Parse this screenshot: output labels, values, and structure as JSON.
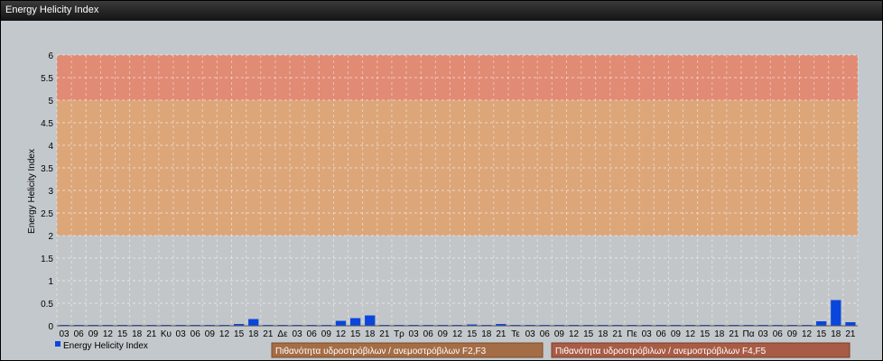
{
  "window": {
    "title": "Energy Helicity Index"
  },
  "colors": {
    "plot_bg": "#b8bec2",
    "zone_low": "#c39b82",
    "zone_mid": "#dca679",
    "zone_high": "#e18a74",
    "bar": "#0a46dc",
    "legend_f23": "#a56d45",
    "legend_f45": "#a95c45"
  },
  "chart_data": {
    "type": "bar",
    "title": "",
    "xlabel": "",
    "ylabel": "Energy Helicity Index",
    "ylim": [
      0,
      6
    ],
    "yticks": [
      "0",
      "0.5",
      "1",
      "1.5",
      "2",
      "2.5",
      "3",
      "3.5",
      "4",
      "4.5",
      "5",
      "5.5",
      "6"
    ],
    "grid": true,
    "categories": [
      "03",
      "06",
      "09",
      "12",
      "15",
      "18",
      "21",
      "Κυ",
      "03",
      "06",
      "09",
      "12",
      "15",
      "18",
      "21",
      "Δε",
      "03",
      "06",
      "09",
      "12",
      "15",
      "18",
      "21",
      "Τρ",
      "03",
      "06",
      "09",
      "12",
      "15",
      "18",
      "21",
      "Τε",
      "03",
      "06",
      "09",
      "12",
      "15",
      "18",
      "21",
      "Πε",
      "03",
      "06",
      "09",
      "12",
      "15",
      "18",
      "21",
      "Πα",
      "03",
      "06",
      "09",
      "12",
      "15",
      "18",
      "21"
    ],
    "series": [
      {
        "name": "Energy Helicity Index",
        "values": [
          0.02,
          0.02,
          0.02,
          0.02,
          0.02,
          0.02,
          0.02,
          0.02,
          0.02,
          0.02,
          0.02,
          0.02,
          0.04,
          0.15,
          0.02,
          0.02,
          0.02,
          0.02,
          0.02,
          0.11,
          0.17,
          0.23,
          0.02,
          0.02,
          0.02,
          0.02,
          0.02,
          0.02,
          0.03,
          0.02,
          0.04,
          0.02,
          0.02,
          0.02,
          0.02,
          0.02,
          0.02,
          0.02,
          0.02,
          0.02,
          0.02,
          0.02,
          0.02,
          0.02,
          0.02,
          0.02,
          0.02,
          0.02,
          0.02,
          0.02,
          0.02,
          0.02,
          0.1,
          0.57,
          0.08
        ]
      }
    ],
    "zones": [
      {
        "from": 0,
        "to": 2,
        "color": "#c2c6c9"
      },
      {
        "from": 2,
        "to": 5,
        "color": "#dca679"
      },
      {
        "from": 5,
        "to": 6,
        "color": "#e18a74"
      }
    ],
    "legend": {
      "series_label": "Energy Helicity Index",
      "zone_labels": [
        "Πιθανότητα υδροστρόβιλων / ανεμοστρόβιλων F2,F3",
        "Πιθανότητα υδροστρόβιλων / ανεμοστρόβιλων F4,F5"
      ]
    }
  }
}
